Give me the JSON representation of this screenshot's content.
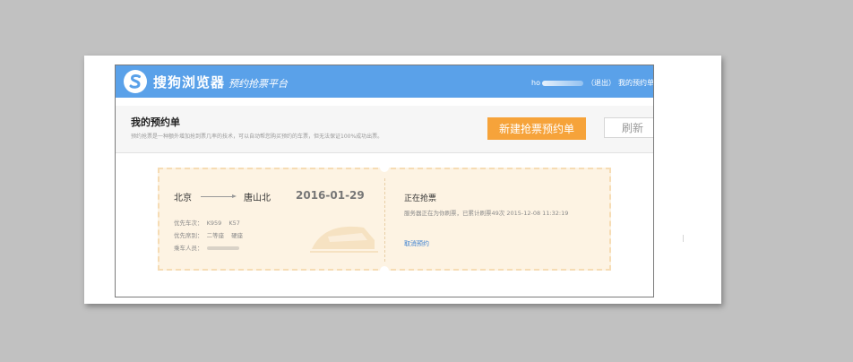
{
  "topbar": {
    "brand": "搜狗浏览器",
    "subbrand": "预约抢票平台",
    "user_prefix": "ho",
    "logout": "（退出）",
    "my_orders": "我的预约单"
  },
  "header": {
    "title": "我的预约单",
    "description": "预约抢票是一种额外增加抢到票几率的技术，可以自动帮您购买预约的车票，但无法保证100%成功出票。",
    "new_button": "新建抢票预约单",
    "refresh_button": "刷新"
  },
  "ticket": {
    "from": "北京",
    "to": "唐山北",
    "date": "2016-01-29",
    "train_label": "优先车次：",
    "trains": [
      "K959",
      "K57"
    ],
    "seat_label": "优先席别：",
    "seats": [
      "二等座",
      "硬座"
    ],
    "passenger_label": "乘车人员：",
    "status": "正在抢票",
    "status_detail": "服务器正在为你刷票，已累计刷票49次 2015-12-08 11:32:19",
    "cancel": "取消预约"
  },
  "colors": {
    "topbar": "#5aa1e9",
    "accent_button": "#f6a33a",
    "ticket_bg": "#fdf3e3",
    "link": "#3a7fd0"
  },
  "icons": {
    "logo": "sogou-logo-icon",
    "arrow": "route-arrow-icon",
    "watermark": "train-watermark-icon"
  }
}
